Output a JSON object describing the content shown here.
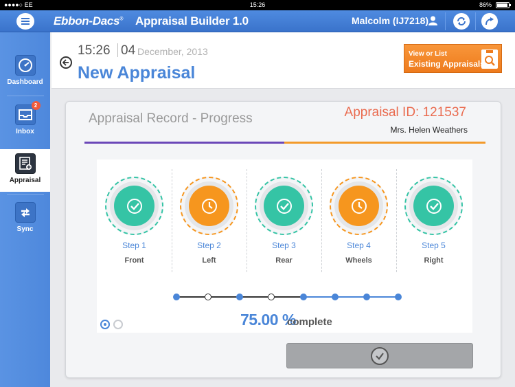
{
  "status_bar": {
    "carrier": "●●●●○ EE",
    "time": "15:26",
    "battery": "86%"
  },
  "topbar": {
    "brand": "Ebbon-Dacs",
    "brand_mark": "®",
    "app_title": "Appraisal Builder 1.0",
    "user": "Malcolm (IJ7218)"
  },
  "sidebar": {
    "items": [
      {
        "label": "Dashboard",
        "icon": "speedometer-icon"
      },
      {
        "label": "Inbox",
        "icon": "inbox-icon",
        "badge": "2"
      },
      {
        "label": "Appraisal",
        "icon": "appraisal-form-icon"
      },
      {
        "label": "Sync",
        "icon": "sync-arrows-icon"
      }
    ],
    "active": "Appraisal"
  },
  "header": {
    "time": "15:26",
    "day": "04",
    "month_year": "December, 2013",
    "title": "New Appraisal",
    "existing_btn_line1": "View or List",
    "existing_btn_line2": "Existing Appraisals"
  },
  "card": {
    "title": "Appraisal Record - Progress",
    "appraisal_id": "Appraisal ID: 121537",
    "customer": "Mrs. Helen Weathers",
    "steps": [
      {
        "label": "Step 1",
        "name": "Front",
        "state": "complete"
      },
      {
        "label": "Step 2",
        "name": "Left",
        "state": "pending"
      },
      {
        "label": "Step 3",
        "name": "Rear",
        "state": "complete"
      },
      {
        "label": "Step 4",
        "name": "Wheels",
        "state": "pending"
      },
      {
        "label": "Step 5",
        "name": "Right",
        "state": "complete"
      }
    ],
    "progress_value": "75.00 %",
    "progress_word": "complete",
    "progress_fraction": 0.75
  },
  "colors": {
    "accent_blue": "#4a86d8",
    "complete_teal": "#35c4a5",
    "pending_orange": "#f6961e",
    "purple_progress": "#6b47b8",
    "orange_progress": "#f39a2a"
  }
}
